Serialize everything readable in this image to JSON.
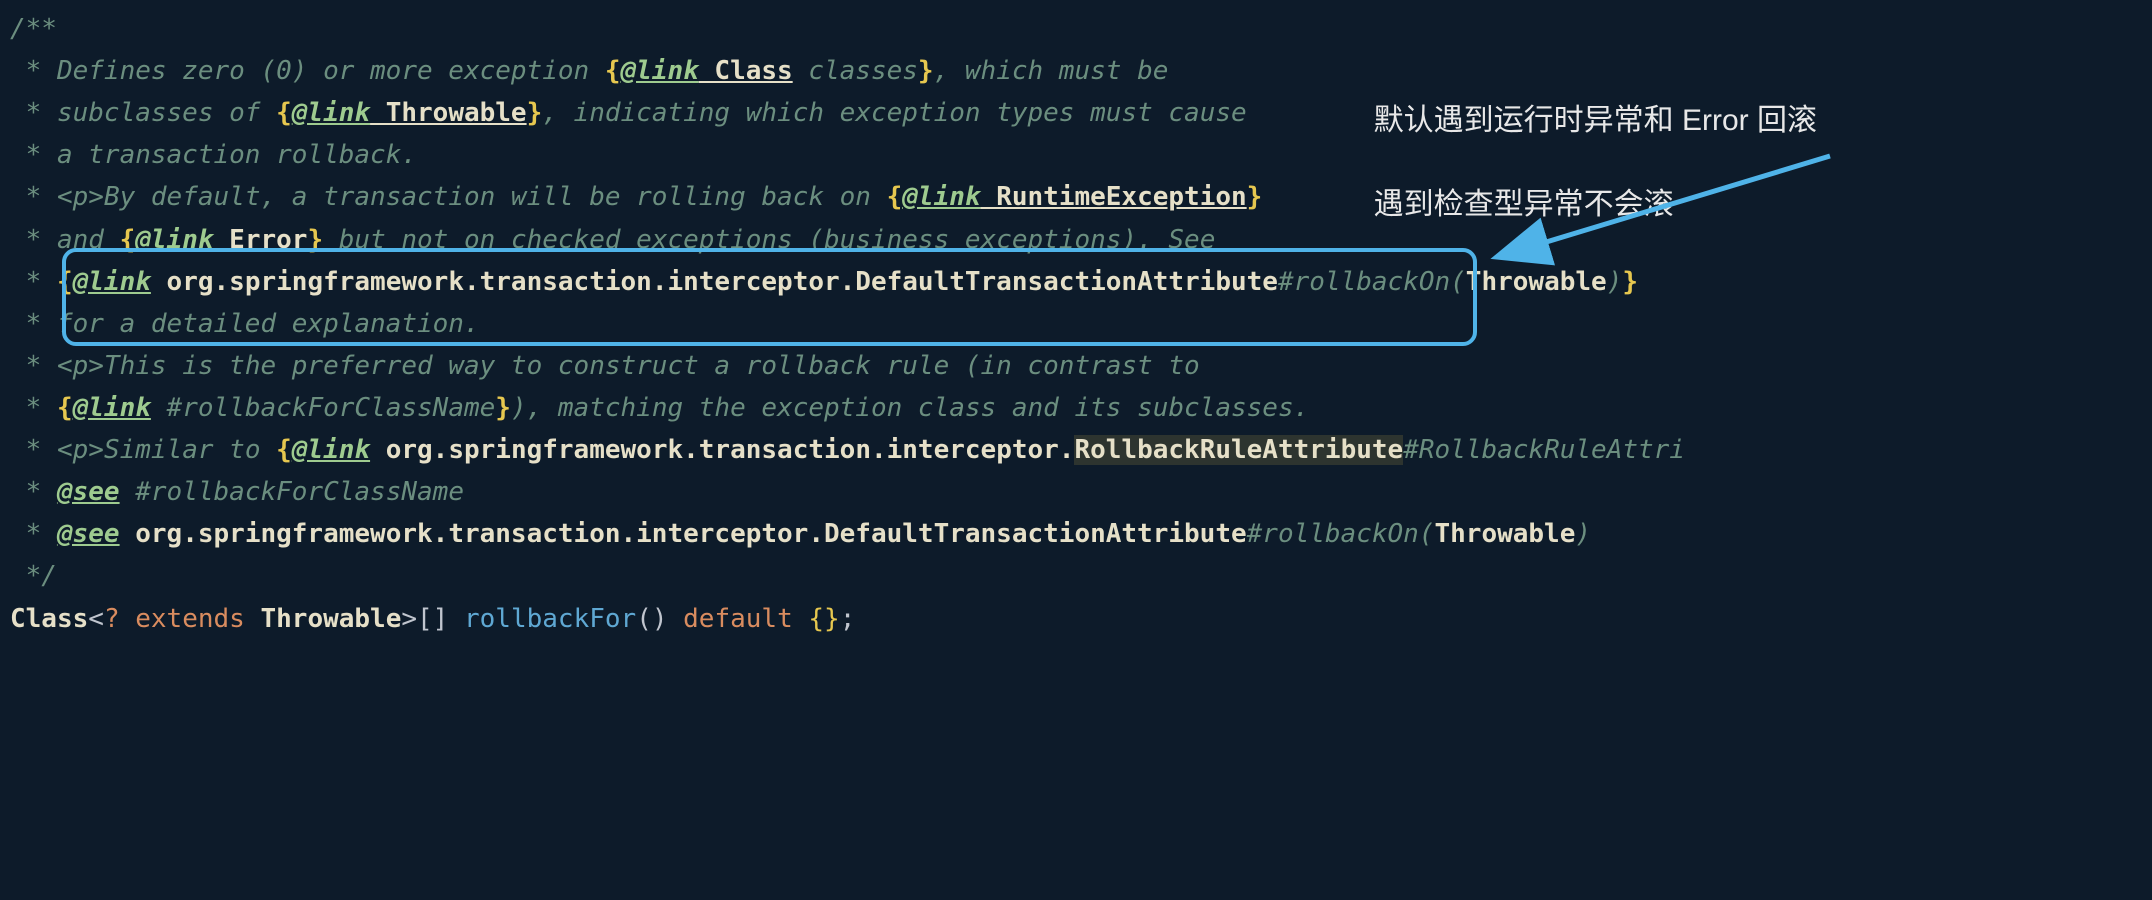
{
  "annotation": {
    "line1": "默认遇到运行时异常和 Error 回滚",
    "line2": "遇到检查型异常不会滚"
  },
  "code": {
    "l01_open": "/**",
    "l02_pre": " * Defines zero (0) or more exception ",
    "l02_obr": "{",
    "l02_ltag": "@link",
    "l02_cls": " Class",
    "l02_post": " classes",
    "l02_cbr": "}",
    "l02_end": ", which must be",
    "l03_pre": " * subclasses of ",
    "l03_obr": "{",
    "l03_ltag": "@link",
    "l03_cls": " Throwable",
    "l03_cbr": "}",
    "l03_end": ", indicating which exception types must cause",
    "l04": " * a transaction rollback.",
    "l05_star": " * ",
    "l05_p": "<p>",
    "l05_txt": "By default, a transaction will be rolling back on ",
    "l05_obr": "{",
    "l05_ltag": "@link",
    "l05_cls": " RuntimeException",
    "l05_cbr": "}",
    "l06_star": " * ",
    "l06_txt": "and ",
    "l06_obr": "{",
    "l06_ltag": "@link",
    "l06_cls": " Error",
    "l06_cbr": "}",
    "l06_end": " but not on checked exceptions (business exceptions). See",
    "l07_star": " * ",
    "l07_obr": "{",
    "l07_ltag": "@link",
    "l07_cls": " org.springframework.transaction.interceptor.DefaultTransactionAttribute",
    "l07_method": "#rollbackOn(",
    "l07_cls2": "Throwable",
    "l07_method2": ")",
    "l07_cbr": "}",
    "l08": " * for a detailed explanation.",
    "l09_star": " * ",
    "l09_p": "<p>",
    "l09_txt": "This is the preferred way to construct a rollback rule (in contrast to",
    "l10_star": " * ",
    "l10_obr": "{",
    "l10_ltag": "@link",
    "l10_method": " #rollbackForClassName",
    "l10_cbr": "}",
    "l10_end": "), matching the exception class and its subclasses.",
    "l11_star": " * ",
    "l11_p": "<p>",
    "l11_txt": "Similar to ",
    "l11_obr": "{",
    "l11_ltag": "@link",
    "l11_cls": " org.springframework.transaction.interceptor.",
    "l11_hl": "RollbackRuleAttribute",
    "l11_method": "#RollbackRuleAttri",
    "l12_star": " * ",
    "l12_stag": "@see",
    "l12_method": " #rollbackForClassName",
    "l13_star": " * ",
    "l13_stag": "@see",
    "l13_cls": " org.springframework.transaction.interceptor.DefaultTransactionAttribute",
    "l13_method": "#rollbackOn(",
    "l13_cls2": "Throwable",
    "l13_method2": ")",
    "l14": " */",
    "sig_cls": "Class",
    "sig_lt": "<",
    "sig_q": "? ",
    "sig_ext": "extends ",
    "sig_thr": "Throwable",
    "sig_gt": ">",
    "sig_arr": "[] ",
    "sig_fn": "rollbackFor",
    "sig_par": "() ",
    "sig_def": "default ",
    "sig_obr": "{",
    "sig_cbr": "}",
    "sig_semi": ";"
  }
}
